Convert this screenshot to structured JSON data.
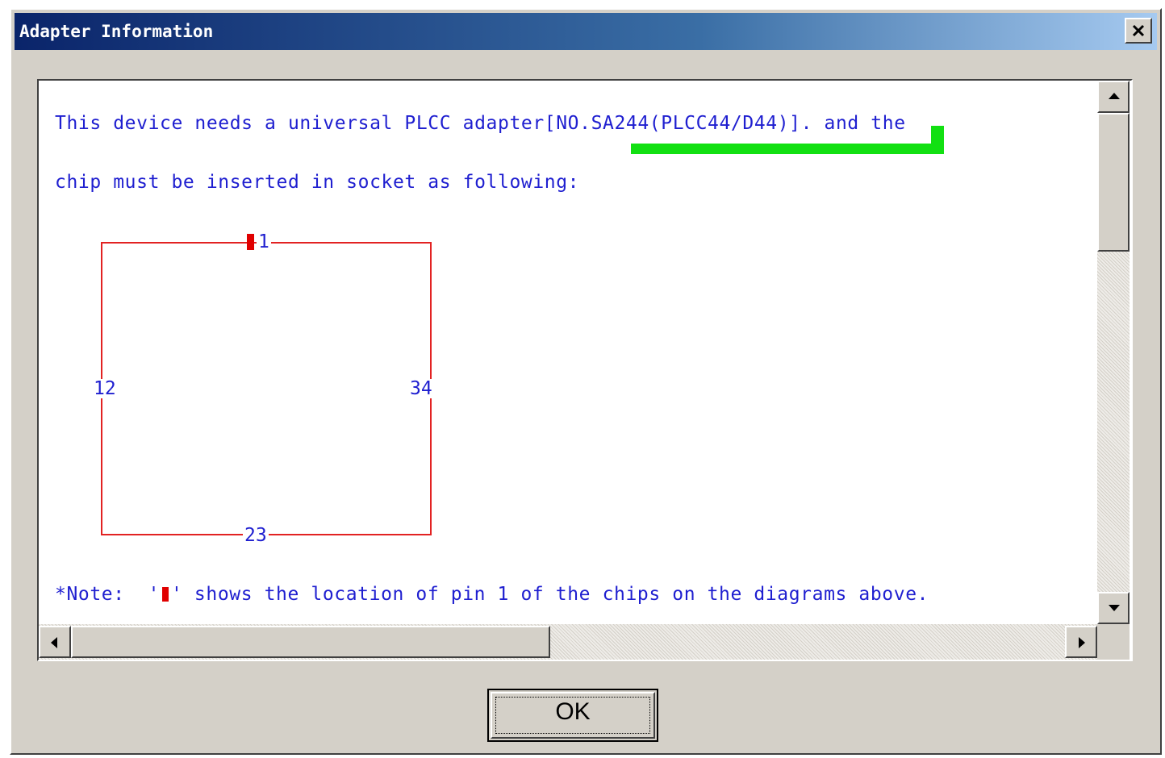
{
  "window": {
    "title": "Adapter Information",
    "close_glyph": "✕"
  },
  "content": {
    "line1_before": "This device needs a universal PLCC adapter",
    "line1_adapter": "[NO.SA244(PLCC44/D44)]",
    "line1_after": ". and the",
    "line2": "chip must be inserted in socket as following:",
    "note_before": "*Note:  '",
    "note_after": "' shows the location of pin 1 of the chips on the diagrams above."
  },
  "diagram": {
    "pin_top": "1",
    "pin_left": "12",
    "pin_right": "34",
    "pin_bottom": "23",
    "outline_color": "#e22222",
    "pin1_marker_color": "#e00000"
  },
  "highlight_color": "#12e012",
  "text_color": "#1f1fd0",
  "buttons": {
    "ok_label": "OK"
  }
}
